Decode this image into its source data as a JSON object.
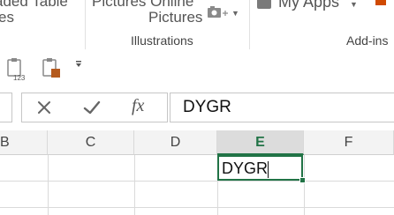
{
  "ribbon": {
    "partial_top_left": "aded Table",
    "partial_left_es": "es",
    "pictures_online": "Pictures Online",
    "pictures": "Pictures",
    "my_apps": "My Apps",
    "group_illustrations": "Illustrations",
    "group_addins": "Add-ins"
  },
  "formula_bar": {
    "name_box_value": "",
    "cancel_icon": "x-icon",
    "enter_icon": "check-icon",
    "function_label": "fx",
    "content": "DYGR"
  },
  "grid": {
    "columns": [
      "B",
      "C",
      "D",
      "E",
      "F"
    ],
    "active_column": "E",
    "active_cell_value": "DYGR"
  },
  "icons": {
    "accent": "#217346"
  }
}
